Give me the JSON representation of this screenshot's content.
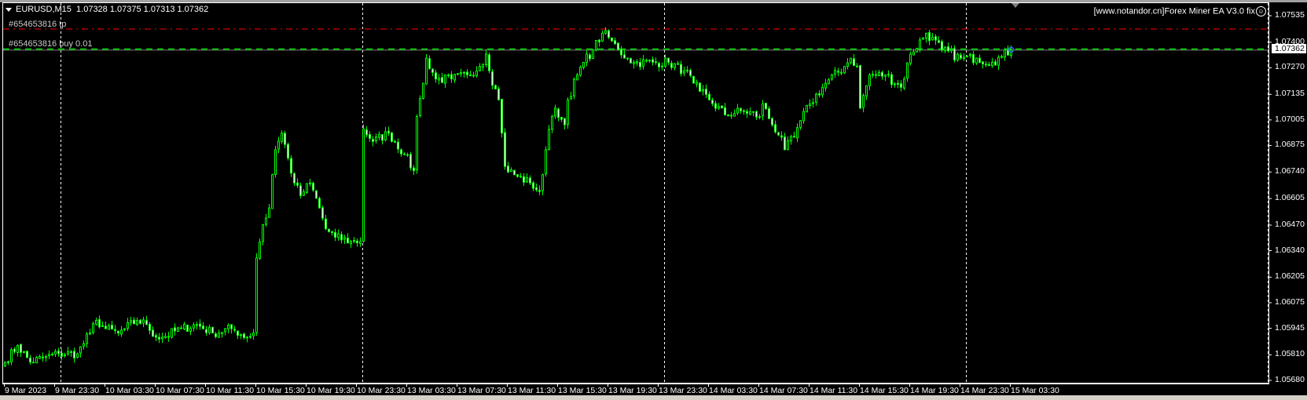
{
  "header": {
    "symbol": "EURUSD,M15",
    "ohlc": "1.07328 1.07375 1.07313 1.07362"
  },
  "orders": {
    "tp_label": "#654653816 tp",
    "buy_label": "#654653816 buy 0.01"
  },
  "expert": {
    "label": "[www.notandor.cn]Forex Miner EA  V3.0 fix",
    "icon": "smiley-icon"
  },
  "current_price": "1.07362",
  "colors": {
    "background": "#000000",
    "candle": "#00ff00",
    "bull_body": "#000000",
    "bear_body": "#ffffff",
    "tp_line": "#ff0000",
    "buy_line": "#00c000",
    "bid_line": "#808080",
    "separator": "#ffffff"
  },
  "chart_data": {
    "type": "candlestick",
    "symbol": "EURUSD",
    "timeframe": "M15",
    "ylim": [
      1.0568,
      1.07535
    ],
    "y_ticks": [
      "1.07535",
      "1.07400",
      "1.07270",
      "1.07135",
      "1.07005",
      "1.06875",
      "1.06740",
      "1.06605",
      "1.06470",
      "1.06340",
      "1.06205",
      "1.06075",
      "1.05945",
      "1.05810",
      "1.05680"
    ],
    "x_ticks": [
      "9 Mar 2023",
      "9 Mar 23:30",
      "10 Mar 03:30",
      "10 Mar 07:30",
      "10 Mar 11:30",
      "10 Mar 15:30",
      "10 Mar 19:30",
      "10 Mar 23:30",
      "13 Mar 03:30",
      "13 Mar 07:30",
      "13 Mar 11:30",
      "13 Mar 15:30",
      "13 Mar 19:30",
      "13 Mar 23:30",
      "14 Mar 03:30",
      "14 Mar 07:30",
      "14 Mar 11:30",
      "14 Mar 15:30",
      "14 Mar 19:30",
      "14 Mar 23:30",
      "15 Mar 03:30"
    ],
    "bars_per_x_tick": 16,
    "period_separators_at_bar": [
      18,
      114,
      210,
      306
    ],
    "levels": {
      "tp": 1.07467,
      "buy": 1.07365,
      "bid": 1.07362
    },
    "close_anchors": [
      [
        0,
        1.05773
      ],
      [
        4,
        1.05858
      ],
      [
        8,
        1.05773
      ],
      [
        12,
        1.05794
      ],
      [
        17,
        1.05816
      ],
      [
        23,
        1.05816
      ],
      [
        27,
        1.05921
      ],
      [
        29,
        1.05985
      ],
      [
        32,
        1.05943
      ],
      [
        36,
        1.05921
      ],
      [
        38,
        1.05943
      ],
      [
        42,
        1.05985
      ],
      [
        45,
        1.05964
      ],
      [
        48,
        1.059
      ],
      [
        50,
        1.059
      ],
      [
        56,
        1.05943
      ],
      [
        61,
        1.05964
      ],
      [
        66,
        1.05921
      ],
      [
        72,
        1.05943
      ],
      [
        77,
        1.059
      ],
      [
        79,
        1.05921
      ],
      [
        80,
        1.06303
      ],
      [
        82,
        1.06472
      ],
      [
        84,
        1.06557
      ],
      [
        85,
        1.06726
      ],
      [
        86,
        1.06853
      ],
      [
        88,
        1.06938
      ],
      [
        90,
        1.06811
      ],
      [
        92,
        1.06684
      ],
      [
        94,
        1.0662
      ],
      [
        97,
        1.06684
      ],
      [
        100,
        1.06557
      ],
      [
        102,
        1.06451
      ],
      [
        105,
        1.06408
      ],
      [
        110,
        1.06387
      ],
      [
        113,
        1.06387
      ],
      [
        114,
        1.06959
      ],
      [
        117,
        1.06895
      ],
      [
        122,
        1.06938
      ],
      [
        127,
        1.06832
      ],
      [
        130,
        1.06747
      ],
      [
        131,
        1.07022
      ],
      [
        133,
        1.07192
      ],
      [
        134,
        1.07319
      ],
      [
        137,
        1.07213
      ],
      [
        142,
        1.07213
      ],
      [
        147,
        1.07234
      ],
      [
        151,
        1.07277
      ],
      [
        153,
        1.0734
      ],
      [
        154,
        1.07255
      ],
      [
        157,
        1.07107
      ],
      [
        158,
        1.06938
      ],
      [
        159,
        1.06768
      ],
      [
        162,
        1.06726
      ],
      [
        167,
        1.06684
      ],
      [
        170,
        1.06641
      ],
      [
        171,
        1.06726
      ],
      [
        172,
        1.06853
      ],
      [
        174,
        1.07022
      ],
      [
        175,
        1.07065
      ],
      [
        178,
        1.0698
      ],
      [
        179,
        1.07107
      ],
      [
        182,
        1.07234
      ],
      [
        184,
        1.07298
      ],
      [
        187,
        1.07361
      ],
      [
        190,
        1.07446
      ],
      [
        192,
        1.07425
      ],
      [
        195,
        1.07361
      ],
      [
        198,
        1.07319
      ],
      [
        200,
        1.07298
      ],
      [
        206,
        1.07298
      ],
      [
        211,
        1.07298
      ],
      [
        216,
        1.07255
      ],
      [
        219,
        1.07192
      ],
      [
        221,
        1.0715
      ],
      [
        224,
        1.07107
      ],
      [
        229,
        1.07031
      ],
      [
        235,
        1.07052
      ],
      [
        240,
        1.07022
      ],
      [
        241,
        1.07086
      ],
      [
        244,
        1.0698
      ],
      [
        247,
        1.06917
      ],
      [
        248,
        1.06853
      ],
      [
        251,
        1.06917
      ],
      [
        253,
        1.07001
      ],
      [
        256,
        1.07086
      ],
      [
        261,
        1.07192
      ],
      [
        267,
        1.07277
      ],
      [
        269,
        1.07319
      ],
      [
        271,
        1.07277
      ],
      [
        272,
        1.07065
      ],
      [
        275,
        1.07234
      ],
      [
        280,
        1.07234
      ],
      [
        285,
        1.07171
      ],
      [
        288,
        1.0734
      ],
      [
        293,
        1.07446
      ],
      [
        298,
        1.07361
      ],
      [
        304,
        1.07319
      ],
      [
        309,
        1.07319
      ],
      [
        314,
        1.07298
      ],
      [
        317,
        1.07328
      ],
      [
        320,
        1.07362
      ]
    ]
  }
}
